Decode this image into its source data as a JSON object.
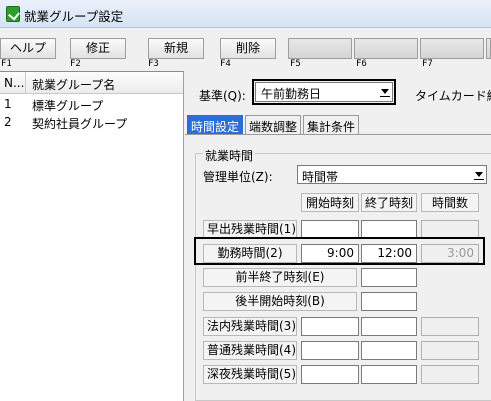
{
  "window": {
    "title": "就業グループ設定"
  },
  "toolbar": {
    "buttons": [
      "ヘルプ",
      "修正",
      "新規",
      "削除",
      "",
      "",
      "",
      ""
    ],
    "fkeys": [
      "F1",
      "F2",
      "F3",
      "F4",
      "F5",
      "F6",
      "F7"
    ]
  },
  "list": {
    "col_no": "N...",
    "col_name": "就業グループ名",
    "rows": [
      {
        "no": "1",
        "name": "標準グループ"
      },
      {
        "no": "2",
        "name": "契約社員グループ"
      }
    ]
  },
  "basis": {
    "label": "基準(Q):",
    "value": "午前勤務日",
    "timecard_label": "タイムカード締"
  },
  "tabs": [
    "時間設定",
    "端数調整",
    "集計条件"
  ],
  "work_time": {
    "group_title": "就業時間",
    "unit_label": "管理単位(Z):",
    "unit_value": "時間帯",
    "columns": [
      "開始時刻",
      "終了時刻",
      "時間数"
    ],
    "rows": [
      {
        "label": "早出残業時間(1)",
        "start": "",
        "end": "",
        "hours": ""
      },
      {
        "label": "勤務時間(2)",
        "start": "9:00",
        "end": "12:00",
        "hours": "3:00"
      },
      {
        "label": "前半終了時刻(E)",
        "start": "",
        "end": "",
        "hours": ""
      },
      {
        "label": "後半開始時刻(B)",
        "start": "",
        "end": "",
        "hours": ""
      },
      {
        "label": "法内残業時間(3)",
        "start": "",
        "end": "",
        "hours": ""
      },
      {
        "label": "普通残業時間(4)",
        "start": "",
        "end": "",
        "hours": ""
      },
      {
        "label": "深夜残業時間(5)",
        "start": "",
        "end": "",
        "hours": ""
      }
    ]
  }
}
